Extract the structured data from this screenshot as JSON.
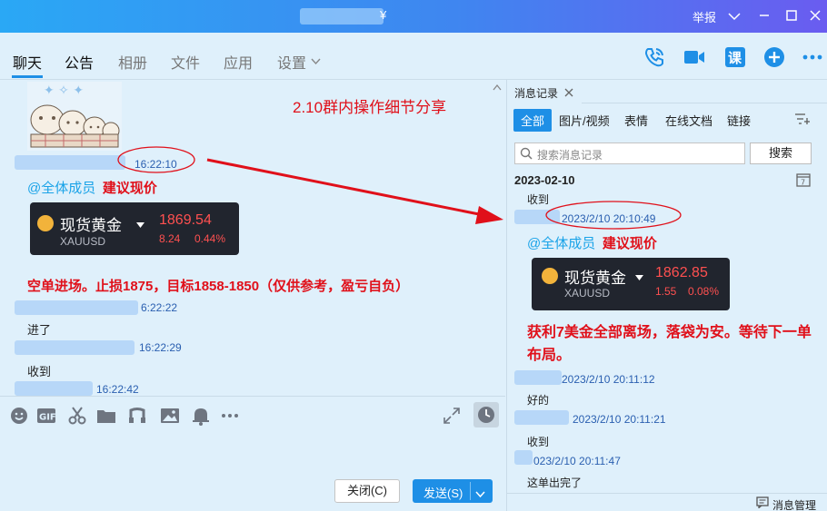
{
  "titlebar": {
    "title_glyph": "¥",
    "report_label": "举报"
  },
  "tabs": [
    {
      "label": "聊天"
    },
    {
      "label": "公告"
    },
    {
      "label": "相册"
    },
    {
      "label": "文件"
    },
    {
      "label": "应用"
    },
    {
      "label": "设置"
    }
  ],
  "top_icons": {
    "course_label": "课"
  },
  "chat": {
    "share_title": "2.10群内操作细节分享",
    "msg1_time": "16:22:10",
    "msg1_mention": "@全体成员",
    "msg1_advice": "建议现价",
    "card1": {
      "name": "现货黄金",
      "code": "XAUUSD",
      "price": "1869.54",
      "change": "8.24",
      "change_pct": "0.44%"
    },
    "msg1_text": "空单进场。止损1875，目标1858-1850（仅供参考，盈亏自负）",
    "msg2_time": "6:22:22",
    "msg2_text": "进了",
    "msg3_time": "16:22:29",
    "msg3_text": "收到",
    "msg4_time": "16:22:42"
  },
  "buttons": {
    "close_label": "关闭(C)",
    "send_label": "发送(S)"
  },
  "panel": {
    "tab_label": "消息记录",
    "filters": [
      "全部",
      "图片/视频",
      "表情",
      "在线文档",
      "链接"
    ],
    "search_placeholder": "搜索消息记录",
    "search_button": "搜索",
    "date": "2023-02-10",
    "first_text": "收到",
    "r1_time": "2023/2/10 20:10:49",
    "r1_mention": "@全体成员",
    "r1_advice": "建议现价",
    "card2": {
      "name": "现货黄金",
      "code": "XAUUSD",
      "price": "1862.85",
      "change": "1.55",
      "change_pct": "0.08%"
    },
    "r1_text": "获利7美金全部离场，落袋为安。等待下一单布局。",
    "r2_time": "2023/2/10 20:11:12",
    "r2_text": "好的",
    "r3_time": "2023/2/10 20:11:21",
    "r3_text": "收到",
    "r4_time": "023/2/10 20:11:47",
    "r4_text": "这单出完了",
    "manage_label": "消息管理"
  }
}
